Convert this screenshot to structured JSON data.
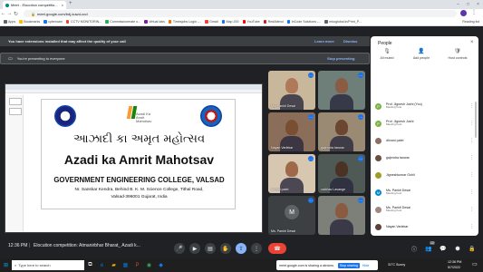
{
  "browser": {
    "tab_active": "Meet - Elocution competitio...",
    "url": "meet.google.com/bdj-kuwd-ocd",
    "bookmarks": [
      {
        "label": "Apps",
        "color": "#5f6368"
      },
      {
        "label": "Bookmarks",
        "color": "#fbbc04"
      },
      {
        "label": "cyberoam",
        "color": "#1a73e8"
      },
      {
        "label": "CCTV MONITORIN...",
        "color": "#ea4335"
      },
      {
        "label": "Commissionerate o...",
        "color": "#34a853"
      },
      {
        "label": "Virtual labs",
        "color": "#7b1fa2"
      },
      {
        "label": "Timesjobs Login -...",
        "color": "#e8710a"
      },
      {
        "label": "Gmail",
        "color": "#ea4335"
      },
      {
        "label": "Map 200",
        "color": "#1a73e8"
      },
      {
        "label": "YouTube",
        "color": "#ff0000"
      },
      {
        "label": "RedAttend",
        "color": "#c5221f"
      },
      {
        "label": "InCode Solutions -...",
        "color": "#1a73e8"
      },
      {
        "label": "mkoglobal.in/Print_P...",
        "color": "#5f6368"
      }
    ],
    "reading_list": "Reading list"
  },
  "banners": {
    "extension_text": "You have extensions installed that may affect the quality of your call",
    "learn_more": "Learn more",
    "dismiss": "Dismiss",
    "presenting_text": "You're presenting to everyone",
    "stop_presenting": "Stop presenting"
  },
  "slide": {
    "logo_text": "Azadi Ka Amrit Mahotsav",
    "gujarati_title": "આઝાદી કા અમૃત મહોત્સવ",
    "english_title": "Azadi ka Amrit Mahotsav",
    "college": "GOVERNMENT ENGINEERING COLLEGE, VALSAD",
    "address_line1": "Nr. Sanskar Kendra, Behind B. K. M. Science College, Tithal Road,",
    "address_line2": "Valsad-396001 Gujarat, India"
  },
  "tiles": [
    {
      "name": "Ms. Pankti Desai",
      "initial": ""
    },
    {
      "name": "",
      "initial": ""
    },
    {
      "name": "Nayan Varlekar",
      "initial": ""
    },
    {
      "name": "gajendra tanwar",
      "initial": ""
    },
    {
      "name": "dhvani patel",
      "initial": ""
    },
    {
      "name": "vaibhav Lavange",
      "initial": ""
    },
    {
      "name": "Ms. Pankti Desai",
      "initial": "M"
    },
    {
      "name": "",
      "initial": ""
    }
  ],
  "people": {
    "title": "People",
    "actions": [
      "All muted",
      "Add people",
      "Host controls"
    ],
    "list": [
      {
        "name": "Prof. Jignesh Joshi (You)",
        "sub": "Meeting host",
        "avatar": "P",
        "color": "#7cb342"
      },
      {
        "name": "Prof. Jignesh Joshi",
        "sub": "Meeting host",
        "avatar": "P",
        "color": "#7cb342"
      },
      {
        "name": "dhvani patel",
        "sub": "",
        "avatar": "",
        "color": "#8d6e63"
      },
      {
        "name": "gajendra tanwar",
        "sub": "",
        "avatar": "",
        "color": "#6d4c41"
      },
      {
        "name": "Jigneshkumar Gohil",
        "sub": "",
        "avatar": "",
        "color": "#9e9d24"
      },
      {
        "name": "Ms. Pankti Desai",
        "sub": "Meeting host",
        "avatar": "M",
        "color": "#0288d1"
      },
      {
        "name": "Ms. Pankti Desai",
        "sub": "Meeting host",
        "avatar": "",
        "color": "#a1887f"
      },
      {
        "name": "Nayan Varlekar",
        "sub": "",
        "avatar": "",
        "color": "#5d4037"
      },
      {
        "name": "vaibhav Lavange",
        "sub": "",
        "avatar": "",
        "color": "#455a64"
      }
    ]
  },
  "meeting": {
    "time": "12:36 PM",
    "separator": "|",
    "title": "Elocution competition: Atmanirbhar Bharat_ Azadi k..."
  },
  "taskbar": {
    "search_placeholder": "Type here to search",
    "share_notice": "meet.google.com is sharing a window.",
    "stop_sharing": "Stop sharing",
    "hide": "Hide",
    "weather": "31°C Sunny",
    "time": "12:36 PM",
    "date": "5/7/2022"
  }
}
